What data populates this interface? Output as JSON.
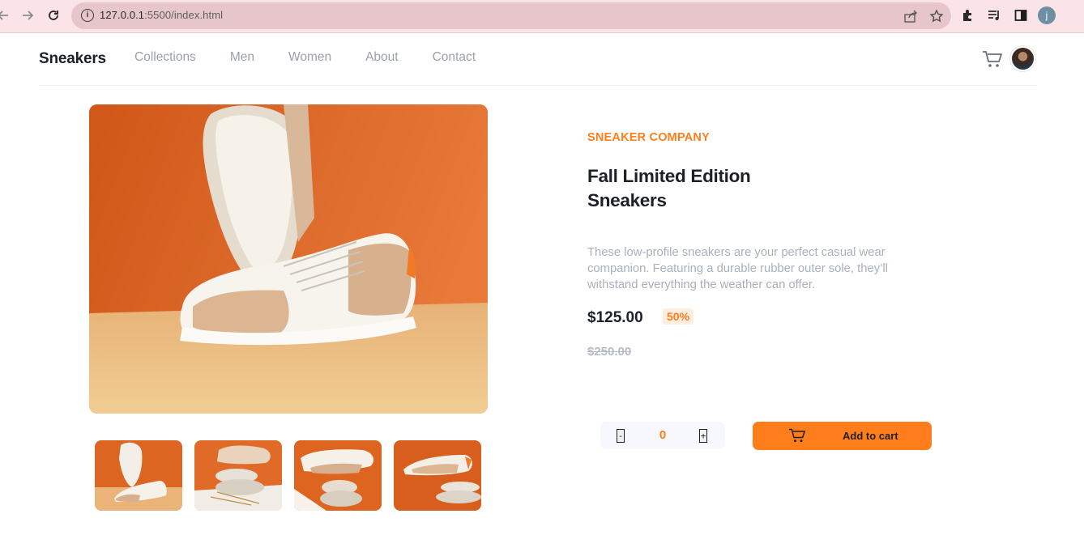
{
  "browser": {
    "url_host": "127.0.0.1",
    "url_path": ":5500/index.html",
    "profile_initial": "j",
    "icons": [
      "back-arrow-icon",
      "forward-arrow-icon",
      "reload-icon",
      "info-icon",
      "share-icon",
      "star-icon",
      "extensions-icon",
      "media-icon",
      "sidepanel-icon"
    ]
  },
  "header": {
    "brand": "Sneakers",
    "menu": [
      "Collections",
      "Men",
      "Women",
      "About",
      "Contact"
    ]
  },
  "product": {
    "company": "SNEAKER COMPANY",
    "title_line1": "Fall Limited Edition",
    "title_line2": "Sneakers",
    "description": "These low-profile sneakers are your perfect casual wear companion. Featuring a durable rubber outer sole, they’ll withstand everything the weather can offer.",
    "price": "$125.00",
    "discount": "50%",
    "old_price": "$250.00"
  },
  "cart_controls": {
    "minus": "-",
    "quantity": "0",
    "plus": "+",
    "add_label": "Add to cart"
  },
  "colors": {
    "accent": "#ff7d1a",
    "pale_accent": "#ffede0",
    "text_dark": "#1d2026",
    "text_muted": "#a9b0bd"
  }
}
